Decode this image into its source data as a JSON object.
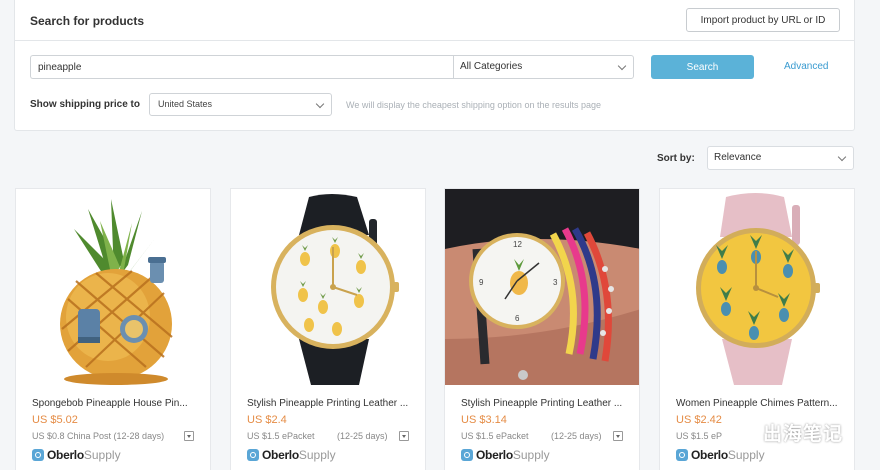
{
  "search": {
    "title": "Search for products",
    "import_label": "Import product by URL or ID",
    "query_value": "pineapple",
    "category": "All Categories",
    "search_label": "Search",
    "advanced_label": "Advanced",
    "shipping_label": "Show shipping price to",
    "shipping_country": "United States",
    "shipping_hint": "We will display the cheapest shipping option on the results page"
  },
  "sort": {
    "label": "Sort by:",
    "value": "Relevance"
  },
  "supplier": {
    "brand": "Oberlo",
    "suffix": "Supply"
  },
  "products": [
    {
      "title": "Spongebob Pineapple House Pin...",
      "price": "US $5.02",
      "shipping": "US $0.8 China Post (12-28 days)",
      "days": ""
    },
    {
      "title": "Stylish Pineapple Printing Leather ...",
      "price": "US $2.4",
      "shipping": "US $1.5 ePacket",
      "days": "(12-25 days)"
    },
    {
      "title": "Stylish Pineapple Printing Leather ...",
      "price": "US $3.14",
      "shipping": "US $1.5 ePacket",
      "days": "(12-25 days)"
    },
    {
      "title": "Women Pineapple Chimes Pattern...",
      "price": "US $2.42",
      "shipping": "US $1.5 eP",
      "days": ""
    }
  ],
  "watermark": "出海笔记",
  "colors": {
    "accent": "#5bb2d8",
    "link": "#3a9bd0",
    "price": "#e58c45",
    "brand_icon": "#5aa6d6"
  }
}
